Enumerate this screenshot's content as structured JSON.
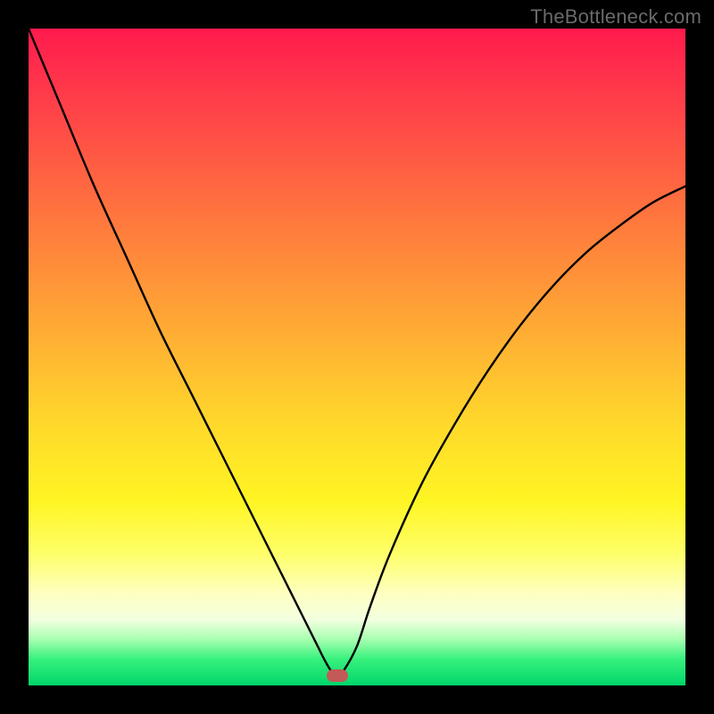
{
  "watermark": "TheBottleneck.com",
  "colors": {
    "frame": "#000000",
    "curve": "#000000",
    "marker": "#c25a58",
    "gradient_top": "#ff1a4d",
    "gradient_bottom": "#00d66a"
  },
  "chart_data": {
    "type": "line",
    "title": "",
    "xlabel": "",
    "ylabel": "",
    "xlim": [
      0,
      100
    ],
    "ylim": [
      0,
      100
    ],
    "annotations": [
      "TheBottleneck.com"
    ],
    "marker": {
      "x": 47,
      "y": 1.5
    },
    "series": [
      {
        "name": "bottleneck-curve",
        "x": [
          0,
          5,
          10,
          15,
          20,
          25,
          30,
          35,
          38,
          40,
          42,
          44,
          45,
          46,
          47,
          48,
          50,
          52,
          55,
          60,
          65,
          70,
          75,
          80,
          85,
          90,
          95,
          100
        ],
        "values": [
          100,
          88,
          76,
          65,
          54,
          44,
          34,
          24,
          18,
          14,
          10,
          6,
          4,
          2.3,
          1.5,
          2.3,
          6,
          12,
          20,
          31,
          40,
          48,
          55,
          61,
          66,
          70,
          73.5,
          76
        ]
      }
    ]
  }
}
